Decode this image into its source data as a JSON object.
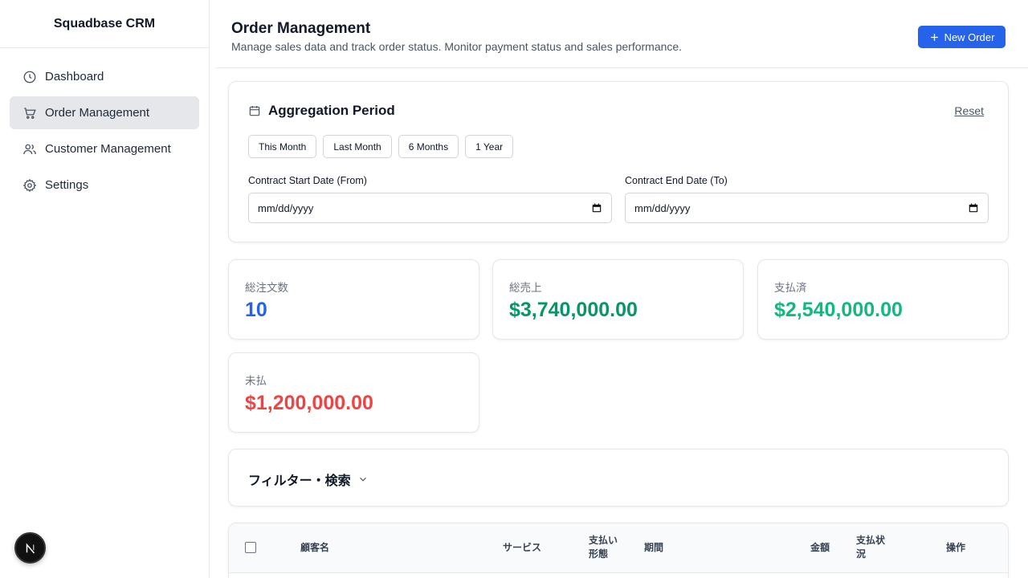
{
  "app": {
    "brand": "Squadbase CRM"
  },
  "sidebar": {
    "items": [
      {
        "label": "Dashboard",
        "icon": "clock-icon",
        "active": false
      },
      {
        "label": "Order Management",
        "icon": "cart-icon",
        "active": true
      },
      {
        "label": "Customer Management",
        "icon": "users-icon",
        "active": false
      },
      {
        "label": "Settings",
        "icon": "gear-icon",
        "active": false
      }
    ]
  },
  "header": {
    "title": "Order Management",
    "subtitle": "Manage sales data and track order status. Monitor payment status and sales performance.",
    "new_order_label": "New Order"
  },
  "period": {
    "title": "Aggregation Period",
    "reset_label": "Reset",
    "chips": [
      "This Month",
      "Last Month",
      "6 Months",
      "1 Year"
    ],
    "start_label": "Contract Start Date (From)",
    "end_label": "Contract End Date (To)",
    "start_placeholder": "mm/dd/yyyy",
    "end_placeholder": "mm/dd/yyyy"
  },
  "stats": [
    {
      "label": "総注文数",
      "value": "10",
      "color": "#2563eb"
    },
    {
      "label": "総売上",
      "value": "$3,740,000.00",
      "color": "#059669"
    },
    {
      "label": "支払済",
      "value": "$2,540,000.00",
      "color": "#10b981"
    },
    {
      "label": "未払",
      "value": "$1,200,000.00",
      "color": "#ef4444"
    }
  ],
  "filter": {
    "title": "フィルター・検索"
  },
  "table": {
    "columns": [
      "顧客名",
      "サービス",
      "支払い形態",
      "期間",
      "金額",
      "支払状況",
      "操作"
    ]
  },
  "colors": {
    "accent": "#2563eb"
  }
}
